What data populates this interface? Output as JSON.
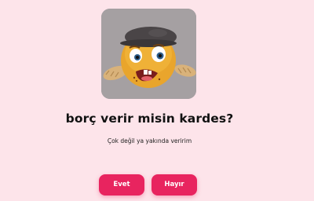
{
  "image": {
    "alt_icon": "sad-poor-emoji-icon"
  },
  "question": "borç verir misin kardes?",
  "subtext": "Çok değil ya yakında veririm",
  "buttons": {
    "yes_label": "Evet",
    "no_label": "Hayır"
  },
  "colors": {
    "background": "#fde4ea",
    "button": "#e8245f",
    "button_text": "#ffffff",
    "question_text": "#111111"
  }
}
